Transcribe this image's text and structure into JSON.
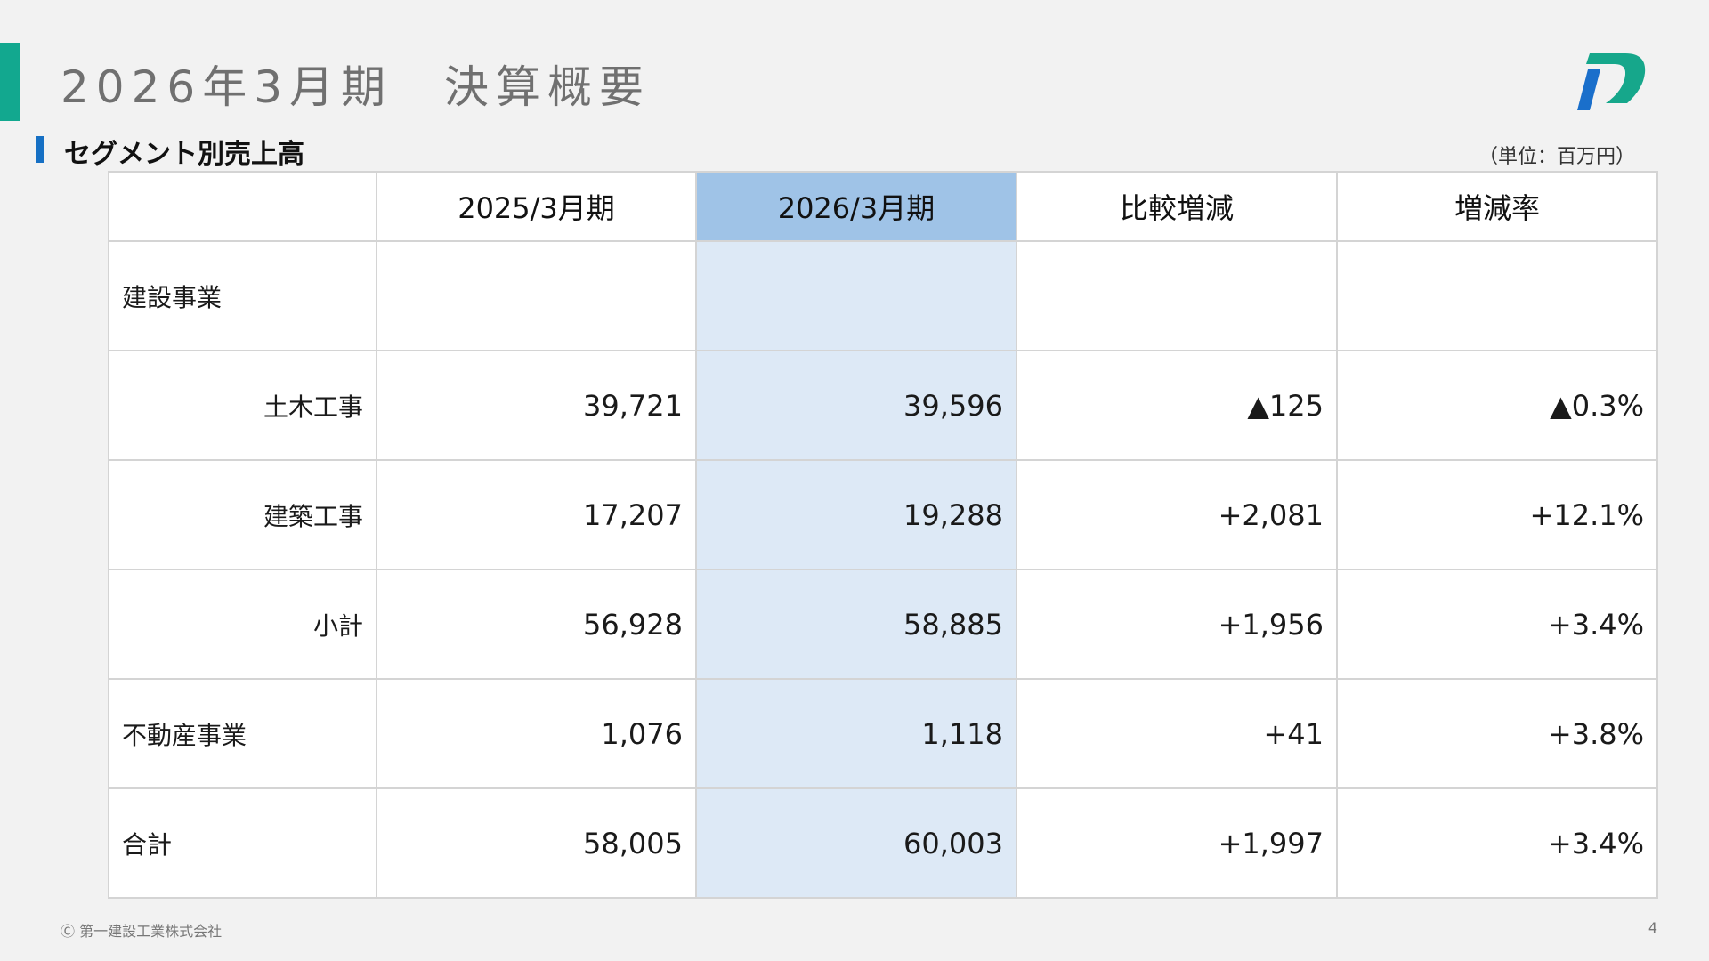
{
  "title": "2026年3月期　決算概要",
  "section_title": "セグメント別売上高",
  "unit_note": "（単位：百万円）",
  "colors": {
    "accent_teal": "#12a88f",
    "accent_blue": "#1670c4",
    "highlight_header": "#9fc3e7",
    "highlight_column": "#dde9f6"
  },
  "logo_icon": "company-logo-icon",
  "table": {
    "headers": [
      "",
      "2025/3月期",
      "2026/3月期",
      "比較増減",
      "増減率"
    ],
    "rows": [
      {
        "label": "建設事業",
        "values": [
          "",
          "",
          "",
          ""
        ]
      },
      {
        "label": "土木工事",
        "values": [
          "39,721",
          "39,596",
          "▲125",
          "▲0.3%"
        ]
      },
      {
        "label": "建築工事",
        "values": [
          "17,207",
          "19,288",
          "+2,081",
          "+12.1%"
        ]
      },
      {
        "label": "小計",
        "values": [
          "56,928",
          "58,885",
          "+1,956",
          "+3.4%"
        ]
      },
      {
        "label": "不動産事業",
        "values": [
          "1,076",
          "1,118",
          "+41",
          "+3.8%"
        ]
      },
      {
        "label": "合計",
        "values": [
          "58,005",
          "60,003",
          "+1,997",
          "+3.4%"
        ]
      }
    ]
  },
  "footer": {
    "copyright": "Ⓒ 第一建設工業株式会社",
    "page_number": "4"
  }
}
